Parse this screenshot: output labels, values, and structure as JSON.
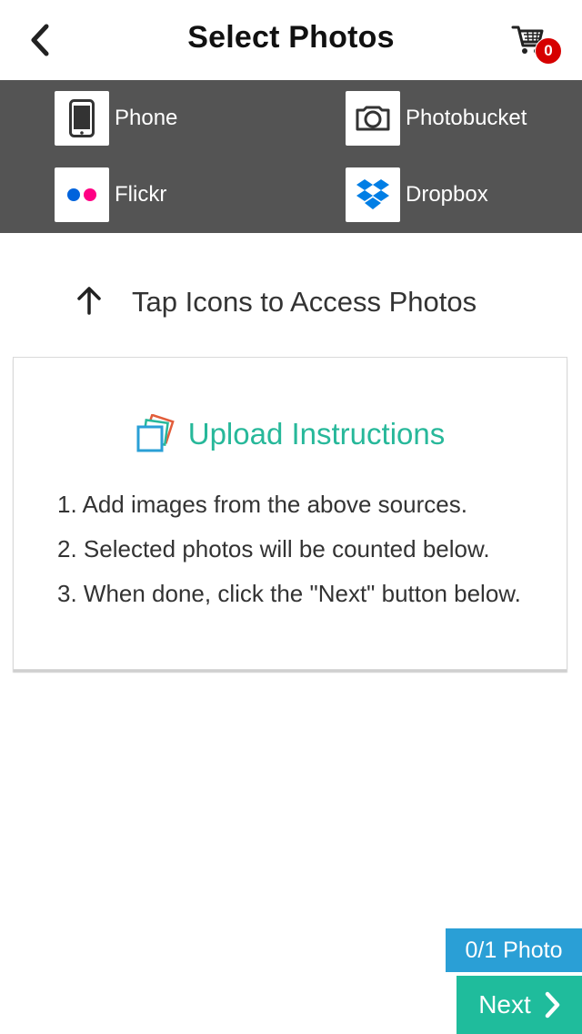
{
  "header": {
    "title": "Select Photos",
    "cart_count": "0"
  },
  "sources": [
    {
      "label": "Phone",
      "icon": "phone-icon"
    },
    {
      "label": "Photobucket",
      "icon": "photobucket-icon"
    },
    {
      "label": "Flickr",
      "icon": "flickr-icon"
    },
    {
      "label": "Dropbox",
      "icon": "dropbox-icon"
    }
  ],
  "hint": {
    "text": "Tap Icons to Access Photos"
  },
  "instructions": {
    "title": "Upload Instructions",
    "steps": [
      "1. Add images from the above sources.",
      "2. Selected photos will be counted below.",
      "3. When done, click the \"Next\" button below."
    ]
  },
  "footer": {
    "photo_count": "0/1 Photo",
    "next_label": "Next"
  },
  "colors": {
    "source_bar": "#545454",
    "accent_green": "#1fbc9c",
    "accent_blue": "#2a9fd6",
    "badge_red": "#d60000",
    "flickr_blue": "#0063dc",
    "flickr_pink": "#ff0084",
    "dropbox_blue": "#007ee5"
  }
}
